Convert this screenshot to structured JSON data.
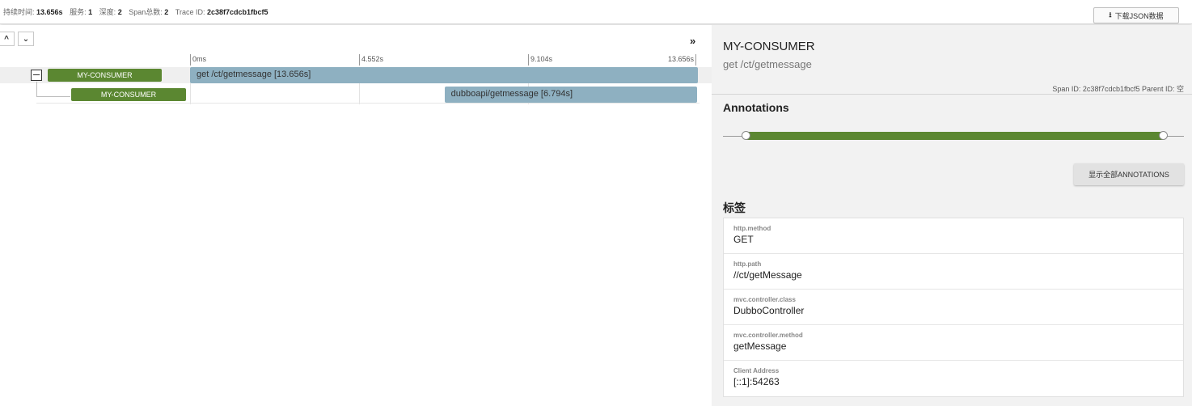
{
  "summary": {
    "duration_label": "持续时间:",
    "duration_value": "13.656s",
    "services_label": "服务:",
    "services_value": "1",
    "depth_label": "深度:",
    "depth_value": "2",
    "spans_label": "Span总数:",
    "spans_value": "2",
    "traceid_label": "Trace ID:",
    "traceid_value": "2c38f7cdcb1fbcf5"
  },
  "toolbar": {
    "download_label": "下载JSON数据",
    "download_icon": "download-icon"
  },
  "timeline": {
    "ticks": [
      "0ms",
      "4.552s",
      "9.104s",
      "13.656s"
    ]
  },
  "rows": [
    {
      "service": "MY-CONSUMER",
      "span_label": "get /ct/getmessage [13.656s]",
      "start_fraction": 0.0,
      "duration_fraction": 1.0
    },
    {
      "service": "MY-CONSUMER",
      "span_label": "dubboapi/getmessage [6.794s]",
      "start_fraction": 0.501,
      "duration_fraction": 0.497
    }
  ],
  "detail": {
    "service": "MY-CONSUMER",
    "span_name": "get /ct/getmessage",
    "ids": "Span ID: 2c38f7cdcb1fbcf5   Parent ID: 空",
    "annotations_heading": "Annotations",
    "show_all_label": "显示全部ANNOTATIONS",
    "tags_heading": "标签",
    "tags": [
      {
        "key": "http.method",
        "value": "GET"
      },
      {
        "key": "http.path",
        "value": "//ct/getMessage"
      },
      {
        "key": "mvc.controller.class",
        "value": "DubboController"
      },
      {
        "key": "mvc.controller.method",
        "value": "getMessage"
      },
      {
        "key": "Client Address",
        "value": "[::1]:54263"
      }
    ]
  },
  "colors": {
    "service_badge": "#5b8731",
    "span_bar": "#8eb0c1",
    "annotation_bar": "#5b8731"
  }
}
